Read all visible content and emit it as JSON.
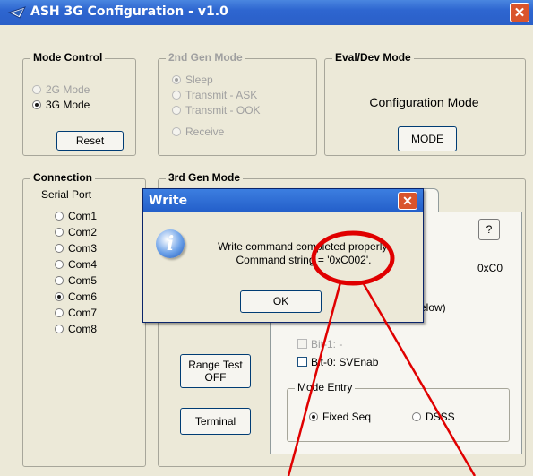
{
  "window": {
    "title": "ASH 3G Configuration - v1.0",
    "close_glyph": "✕"
  },
  "mode_control": {
    "legend": "Mode Control",
    "options": [
      {
        "label": "2G Mode",
        "selected": false,
        "enabled": false
      },
      {
        "label": "3G Mode",
        "selected": true,
        "enabled": true
      }
    ],
    "reset_label": "Reset"
  },
  "second_gen": {
    "legend": "2nd Gen Mode",
    "options": [
      {
        "label": "Sleep",
        "selected": true
      },
      {
        "label": "Transmit - ASK",
        "selected": false
      },
      {
        "label": "Transmit - OOK",
        "selected": false
      },
      {
        "label": "Receive",
        "selected": false
      }
    ]
  },
  "eval_dev": {
    "legend": "Eval/Dev Mode",
    "mode_text": "Configuration Mode",
    "mode_button": "MODE"
  },
  "connection": {
    "legend": "Connection",
    "serial_label": "Serial Port",
    "ports": [
      {
        "label": "Com1",
        "selected": false
      },
      {
        "label": "Com2",
        "selected": false
      },
      {
        "label": "Com3",
        "selected": false
      },
      {
        "label": "Com4",
        "selected": false
      },
      {
        "label": "Com5",
        "selected": false
      },
      {
        "label": "Com6",
        "selected": true
      },
      {
        "label": "Com7",
        "selected": false
      },
      {
        "label": "Com8",
        "selected": false
      }
    ]
  },
  "third_gen": {
    "legend": "3rd Gen Mode",
    "help_button": "?",
    "hex_value": "0xC0",
    "partial_text": "elow)",
    "bit1_label": "Bit-1: -",
    "bit0_label": "Bit-0:  SVEnab",
    "range_test_line1": "Range Test",
    "range_test_line2": "OFF",
    "terminal_label": "Terminal",
    "mode_entry": {
      "legend": "Mode Entry",
      "options": [
        {
          "label": "Fixed Seq",
          "selected": true
        },
        {
          "label": "DSSS",
          "selected": false
        }
      ]
    }
  },
  "dialog": {
    "title": "Write",
    "close_glyph": "✕",
    "icon_glyph": "i",
    "message_line1": "Write command completed properly.",
    "message_line2": "Command string = '0xC002'.",
    "ok_label": "OK"
  },
  "colors": {
    "titlebar": "#2e66d0",
    "annotation_red": "#e00000",
    "window_bg": "#ece9d8"
  }
}
